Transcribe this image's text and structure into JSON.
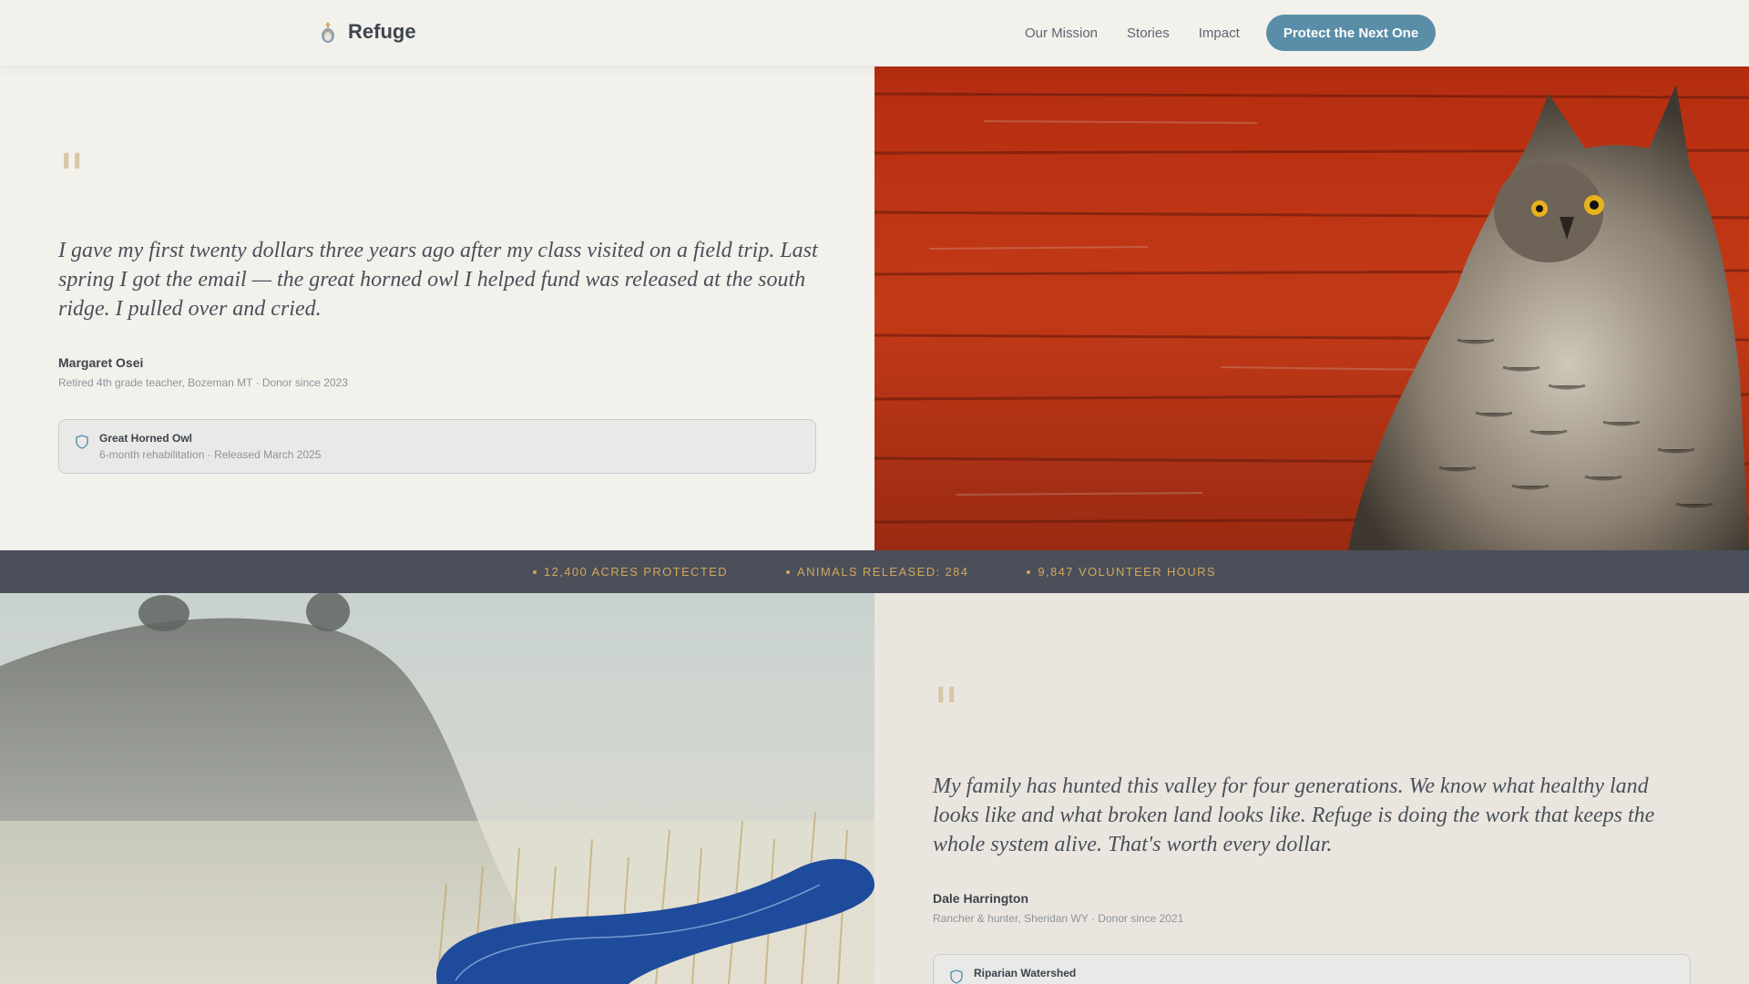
{
  "header": {
    "brand": "Refuge",
    "nav": [
      "Our Mission",
      "Stories",
      "Impact"
    ],
    "cta": "Protect the Next One"
  },
  "stories": [
    {
      "quote_mark": "\"",
      "quote": "I gave my first twenty dollars three years ago after my class visited on a field trip. Last spring I got the email — the great horned owl I helped fund was released at the south ridge. I pulled over and cried.",
      "author": "Margaret Osei",
      "author_meta": "Retired 4th grade teacher, Bozeman MT · Donor since 2023",
      "card": {
        "icon": "shield-icon",
        "title": "Great Horned Owl",
        "meta": "6-month rehabilitation · Released March 2025"
      }
    },
    {
      "quote_mark": "\"",
      "quote": "My family has hunted this valley for four generations. We know what healthy land looks like and what broken land looks like. Refuge is doing the work that keeps the whole system alive. That's worth every dollar.",
      "author": "Dale Harrington",
      "author_meta": "Rancher & hunter, Sheridan WY · Donor since 2021",
      "card": {
        "icon": "shield-icon",
        "title": "Riparian Watershed"
      }
    }
  ],
  "stats": [
    "12,400 ACRES PROTECTED",
    "ANIMALS RELEASED: 284",
    "9,847 VOLUNTEER HOURS"
  ],
  "colors": {
    "accent": "#5a8ea8",
    "background": "#f3f1ec",
    "stats_bar": "#4a4f5a",
    "stats_text": "#d4a65a",
    "quote_mark": "#d6c6a4"
  }
}
